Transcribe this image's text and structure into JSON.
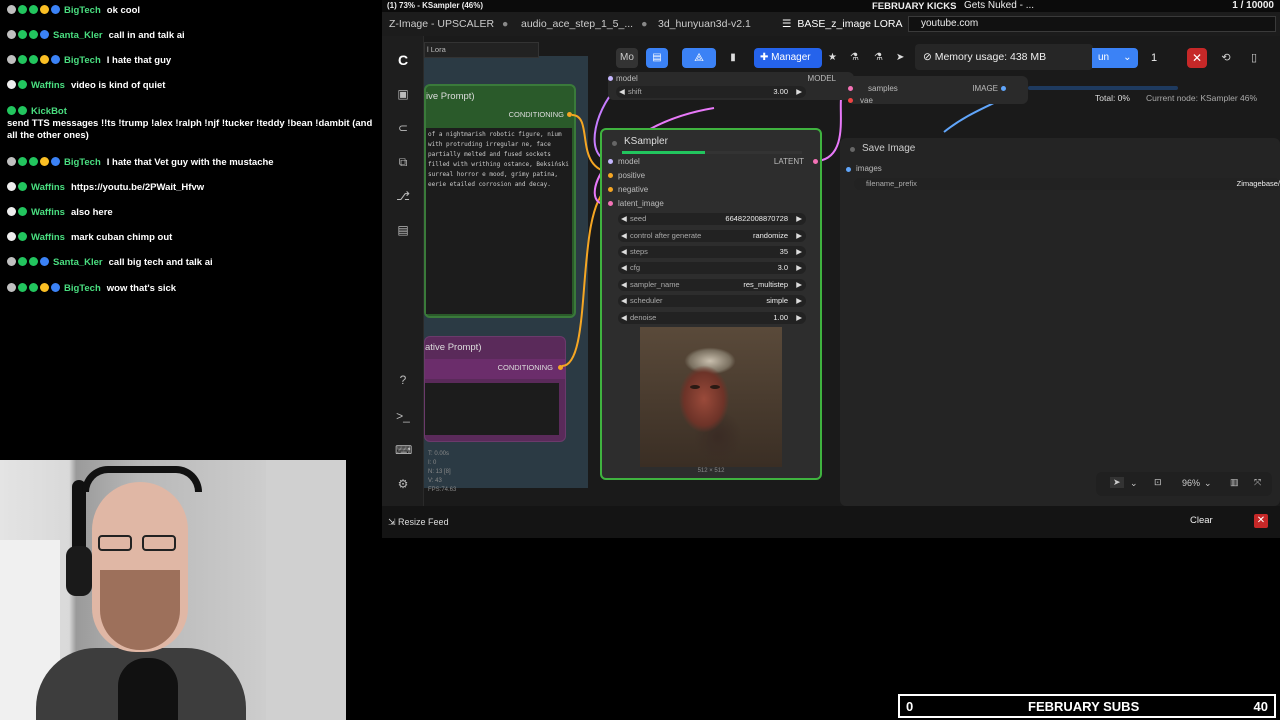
{
  "colors": {
    "chat_user_green": "#4ade80",
    "chat_user_blue": "#60a5fa",
    "accent": "#3b82f6",
    "node_green": "#2e7d32",
    "node_purple": "#6b2d6b",
    "danger": "#e53935"
  },
  "chat": {
    "messages": [
      {
        "user": "BigTech",
        "text": "ok cool"
      },
      {
        "user": "Santa_Kler",
        "text": "call in and talk ai"
      },
      {
        "user": "BigTech",
        "text": "I hate that guy"
      },
      {
        "user": "Waffins",
        "text": "video is kind of quiet"
      },
      {
        "user": "KickBot",
        "text": "send TTS messages !!ts !trump !alex !ralph !njf !tucker !teddy !bean !dambit (and all the other ones)"
      },
      {
        "user": "BigTech",
        "text": "I hate that Vet guy with the mustache"
      },
      {
        "user": "Waffins",
        "text": "https://youtu.be/2PWait_Hfvw"
      },
      {
        "user": "Waffins",
        "text": "also here"
      },
      {
        "user": "Waffins",
        "text": "mark cuban chimp out"
      },
      {
        "user": "Santa_Kler",
        "text": "call big tech and talk ai"
      },
      {
        "user": "BigTech",
        "text": "wow that's sick"
      }
    ]
  },
  "window": {
    "title": "(1) 73% - KSampler (46%)"
  },
  "overlay": {
    "kicks_title": "FEBRUARY KICKS",
    "news_title": "Gets Nuked - ...",
    "kicks_count": "1 / 10000",
    "url": "youtube.com"
  },
  "tabs": [
    "Z-Image - UPSCALER",
    "audio_ace_step_1_5_...",
    "3d_hunyuan3d-v2.1",
    "BASE_z_image LORA"
  ],
  "toolbar": {
    "manager": "Manager",
    "run_label": "un",
    "batch": "1",
    "memory": "Memory usage: 438 MB",
    "total": "Total: 0%",
    "current_node": "Current node: KSampler 46%",
    "lora_label": "l Lora",
    "mo_label": "Mo"
  },
  "nodes": {
    "positive": {
      "title": "ive Prompt)",
      "output": "CONDITIONING",
      "text": "of a nightmarish robotic figure, nium with protruding irregular ne, face partially melted and fused sockets filled with writhing ostance, Beksiński surreal horror e mood, grimy patina, eerie etailed corrosion and decay."
    },
    "negative": {
      "title": "ative Prompt)",
      "output": "CONDITIONING"
    },
    "model_top": {
      "model_label": "model",
      "model_out": "MODEL",
      "shift_label": "shift",
      "shift_value": "3.00"
    },
    "ksampler": {
      "title": "KSampler",
      "output": "LATENT",
      "inputs": [
        "model",
        "positive",
        "negative",
        "latent_image"
      ],
      "widgets": [
        {
          "label": "seed",
          "value": "664822008870728"
        },
        {
          "label": "control after generate",
          "value": "randomize"
        },
        {
          "label": "steps",
          "value": "35"
        },
        {
          "label": "cfg",
          "value": "3.0"
        },
        {
          "label": "sampler_name",
          "value": "res_multistep"
        },
        {
          "label": "scheduler",
          "value": "simple"
        },
        {
          "label": "denoise",
          "value": "1.00"
        }
      ],
      "preview_size": "512 × 512",
      "progress": 0.46
    },
    "vae_decode": {
      "samples": "samples",
      "vae": "vae",
      "out": "IMAGE"
    },
    "save_image": {
      "title": "Save Image",
      "input": "images",
      "prefix_label": "filename_prefix",
      "prefix_value": "Zimagebase/"
    }
  },
  "stats": {
    "t": "T: 0.00s",
    "i": "I: 0",
    "n": "N: 13 [8]",
    "v": "V: 43",
    "fps": "FPS:74.63"
  },
  "canvas_controls": {
    "zoom": "96%"
  },
  "bottom": {
    "resize_feed": "Resize Feed",
    "clear": "Clear"
  },
  "subs": {
    "left": "0",
    "title": "FEBRUARY SUBS",
    "right": "40"
  }
}
